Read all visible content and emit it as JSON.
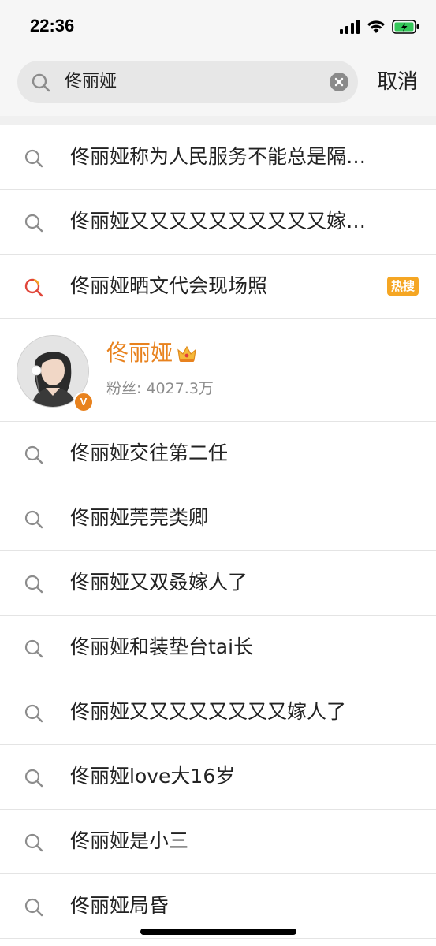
{
  "status_bar": {
    "time": "22:36"
  },
  "search": {
    "query": "佟丽娅",
    "cancel_label": "取消"
  },
  "colors": {
    "accent_orange": "#e8821e",
    "hot_badge": "#f5a623",
    "hot_icon_red": "#e0463a"
  },
  "suggestions_top": [
    {
      "text": "佟丽娅称为人民服务不能总是隔…",
      "icon": "search-icon"
    },
    {
      "text": "佟丽娅又又又又又又又又又又嫁…",
      "icon": "search-icon"
    },
    {
      "text": "佟丽娅晒文代会现场照",
      "icon": "hot-search-icon",
      "badge": "热搜"
    }
  ],
  "user": {
    "name": "佟丽娅",
    "fans": "粉丝: 4027.3万",
    "verified_mark": "V",
    "crown_icon": "crown-icon"
  },
  "suggestions_bottom": [
    {
      "text": "佟丽娅交往第二任"
    },
    {
      "text": "佟丽娅莞莞类卿"
    },
    {
      "text": "佟丽娅又双叒嫁人了"
    },
    {
      "text": "佟丽娅和装垫台tai长"
    },
    {
      "text": "佟丽娅又又又又又又又又嫁人了"
    },
    {
      "text": "佟丽娅love大16岁"
    },
    {
      "text": "佟丽娅是小三"
    },
    {
      "text": "佟丽娅局昏"
    }
  ]
}
